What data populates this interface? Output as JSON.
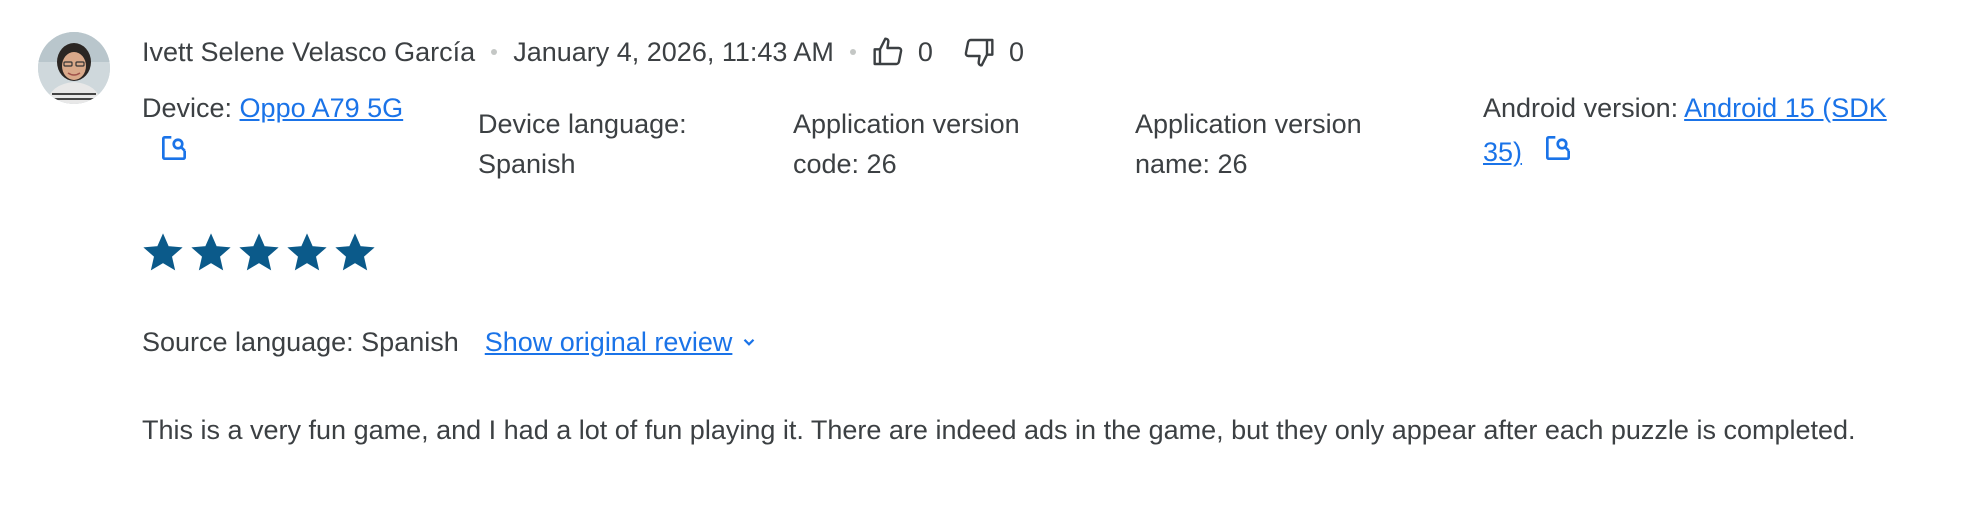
{
  "review": {
    "author": "Ivett Selene Velasco García",
    "date": "January 4, 2026, 11:43 AM",
    "thumbs_up_count": "0",
    "thumbs_down_count": "0",
    "rating": 5,
    "rating_max": 5
  },
  "device": {
    "label": "Device:",
    "value": "Oppo A79 5G"
  },
  "device_language": {
    "label": "Device language:",
    "value": "Spanish"
  },
  "app_version_code": {
    "label": "Application version",
    "label2": "code: 26"
  },
  "app_version_name": {
    "label": "Application version",
    "label2": "name: 26"
  },
  "android_version": {
    "label": "Android version:",
    "value_line1": "Android 15 (SDK",
    "value_line2": "35)"
  },
  "translation": {
    "source_language": "Source language: Spanish",
    "show_original": "Show original review"
  },
  "review_text": "This is a very fun game, and I had a lot of fun playing it. There are indeed ads in the game, but they only appear after each puzzle is completed.",
  "colors": {
    "star": "#0b5a8a",
    "link": "#1a73e8",
    "text": "#3c4043"
  },
  "icons": {
    "thumbs_up": "thumbs-up-icon",
    "thumbs_down": "thumbs-down-icon",
    "external": "open-in-new-search-icon",
    "chevron": "chevron-down-icon"
  }
}
